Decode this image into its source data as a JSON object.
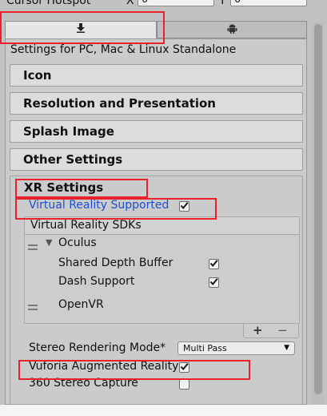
{
  "cursor_hotspot": {
    "label": "Cursor Hotspot",
    "x_label": "X",
    "x_value": "0",
    "y_label": "Y",
    "y_value": "0"
  },
  "tabs": [
    {
      "name": "standalone",
      "icon": "download-icon",
      "active": true
    },
    {
      "name": "android",
      "icon": "android-icon",
      "active": false
    }
  ],
  "settings_for": "Settings for PC, Mac & Linux Standalone",
  "sections": {
    "icon": "Icon",
    "resolution": "Resolution and Presentation",
    "splash": "Splash Image",
    "other": "Other Settings",
    "xr": "XR Settings"
  },
  "xr": {
    "vr_supported_label": "Virtual Reality Supported",
    "vr_supported_checked": true,
    "sdks_header": "Virtual Reality SDKs",
    "sdks": [
      {
        "name": "Oculus",
        "expanded": true,
        "options": [
          {
            "label": "Shared Depth Buffer",
            "checked": true
          },
          {
            "label": "Dash Support",
            "checked": true
          }
        ]
      },
      {
        "name": "OpenVR"
      }
    ],
    "add_symbol": "+",
    "remove_symbol": "−",
    "stereo_mode_label": "Stereo Rendering Mode*",
    "stereo_mode_value": "Multi Pass",
    "vuforia_label": "Vuforia Augmented Reality",
    "vuforia_checked": true,
    "stereo360_label": "360 Stereo Capture",
    "stereo360_checked": false
  },
  "colors": {
    "highlight_box": "#e8232e",
    "link_blue": "#1d4fd3"
  }
}
